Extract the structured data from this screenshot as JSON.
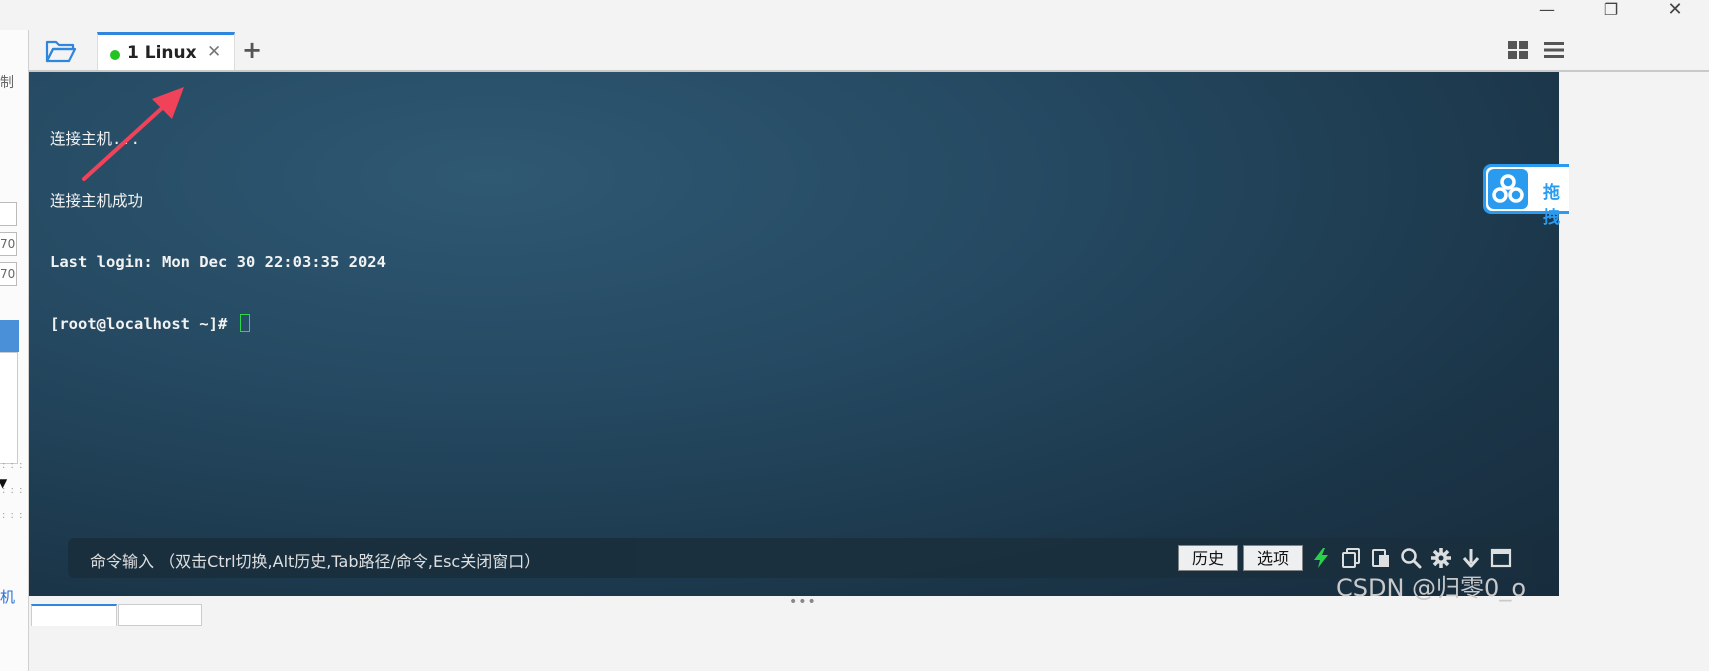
{
  "window": {
    "minimize": "—",
    "restore": "❐",
    "close": "✕"
  },
  "left_panel": {
    "fragment_top": "制",
    "box1": "",
    "box2": "70",
    "box3": "70",
    "dots1": ": : :",
    "dots2": ": : :",
    "dots3": ": : :",
    "bottom_label": "机"
  },
  "tabs": [
    {
      "label": "1 Linux",
      "status_color": "#22c322",
      "active": true
    }
  ],
  "terminal": {
    "lines": [
      "连接主机...",
      "连接主机成功",
      "Last login: Mon Dec 30 22:03:35 2024",
      "[root@localhost ~]# "
    ]
  },
  "float_widget": {
    "label": "拖拽"
  },
  "command_bar": {
    "hint": "命令输入 （双击Ctrl切换,Alt历史,Tab路径/命令,Esc关闭窗口）",
    "history_button": "历史",
    "options_button": "选项"
  },
  "watermark": "CSDN @归零0_o",
  "colors": {
    "accent": "#2e86de",
    "terminal_bg": "#244860",
    "cursor": "#2bd94a",
    "annotation": "#f0435a"
  }
}
